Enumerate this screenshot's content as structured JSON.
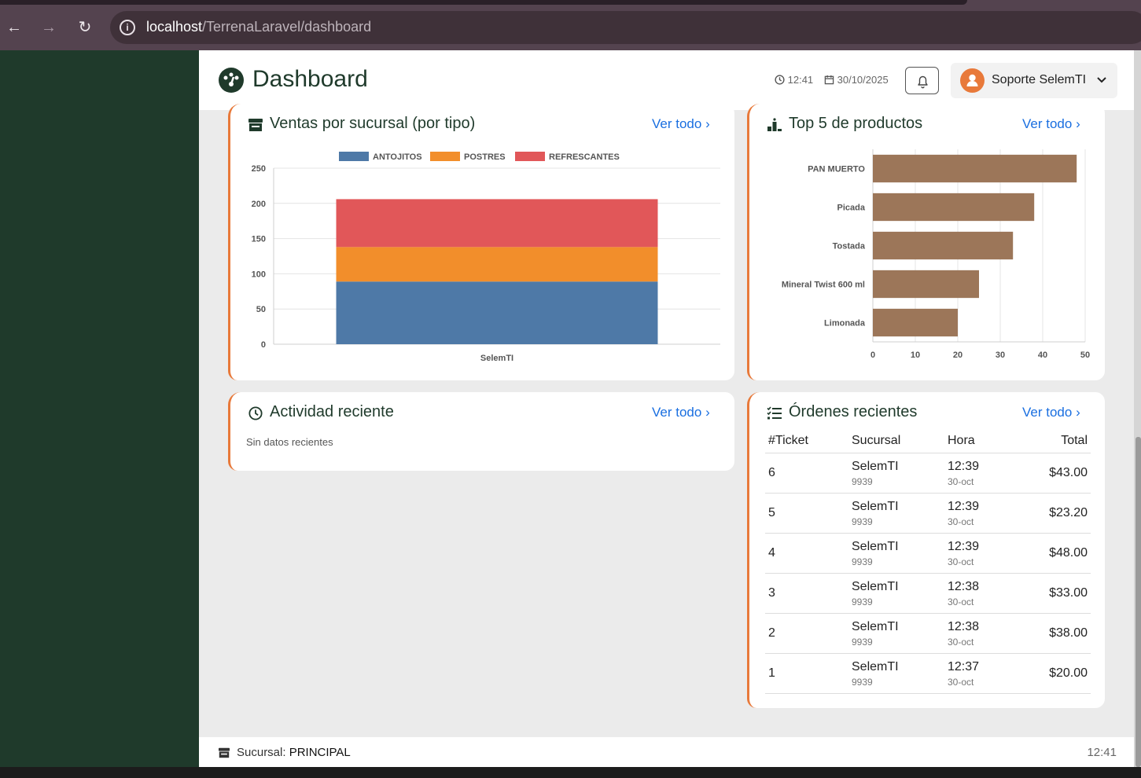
{
  "browser": {
    "url_host": "localhost",
    "url_path": "/TerrenaLaravel/dashboard",
    "back_icon": "←",
    "forward_icon": "→",
    "reload_icon": "↻",
    "info_icon": "i"
  },
  "header": {
    "title": "Dashboard",
    "time": "12:41",
    "date": "30/10/2025",
    "user_name": "Soporte SelemTI",
    "user_chevron": "⌄"
  },
  "ventas_card": {
    "title": "Ventas por sucursal (por tipo)",
    "link": "Ver todo",
    "chevron": "›"
  },
  "top5_card": {
    "title": "Top 5 de productos",
    "link": "Ver todo",
    "chevron": "›"
  },
  "actividad_card": {
    "title": "Actividad reciente",
    "link": "Ver todo",
    "chevron": "›",
    "empty": "Sin datos recientes"
  },
  "ordenes_card": {
    "title": "Órdenes recientes",
    "link": "Ver todo",
    "chevron": "›",
    "columns": [
      "#Ticket",
      "Sucursal",
      "Hora",
      "Total"
    ],
    "rows": [
      {
        "ticket": "6",
        "sucursal": "SelemTI",
        "sucursal_code": "9939",
        "hora": "12:39",
        "fecha": "30-oct",
        "total": "$43.00"
      },
      {
        "ticket": "5",
        "sucursal": "SelemTI",
        "sucursal_code": "9939",
        "hora": "12:39",
        "fecha": "30-oct",
        "total": "$23.20"
      },
      {
        "ticket": "4",
        "sucursal": "SelemTI",
        "sucursal_code": "9939",
        "hora": "12:39",
        "fecha": "30-oct",
        "total": "$48.00"
      },
      {
        "ticket": "3",
        "sucursal": "SelemTI",
        "sucursal_code": "9939",
        "hora": "12:38",
        "fecha": "30-oct",
        "total": "$33.00"
      },
      {
        "ticket": "2",
        "sucursal": "SelemTI",
        "sucursal_code": "9939",
        "hora": "12:38",
        "fecha": "30-oct",
        "total": "$38.00"
      },
      {
        "ticket": "1",
        "sucursal": "SelemTI",
        "sucursal_code": "9939",
        "hora": "12:37",
        "fecha": "30-oct",
        "total": "$20.00"
      }
    ]
  },
  "footer": {
    "label": "Sucursal:",
    "branch": "PRINCIPAL",
    "time": "12:41"
  },
  "colors": {
    "sidebar": "#1f3a2b",
    "accent": "#e8793a",
    "link": "#1a6fe0",
    "antojitos": "#4e79a7",
    "postres": "#f28e2b",
    "refrescantes": "#e15759",
    "top5_bar": "#9c7659"
  },
  "chart_data": [
    {
      "type": "bar",
      "stacked": true,
      "categories": [
        "SelemTI"
      ],
      "series": [
        {
          "name": "ANTOJITOS",
          "values": [
            89
          ]
        },
        {
          "name": "POSTRES",
          "values": [
            49
          ]
        },
        {
          "name": "REFRESCANTES",
          "values": [
            68
          ]
        }
      ],
      "ylim": [
        0,
        250
      ],
      "yticks": [
        0,
        50,
        100,
        150,
        200,
        250
      ],
      "legend": "top",
      "grid": true
    },
    {
      "type": "bar",
      "orientation": "horizontal",
      "categories": [
        "PAN MUERTO",
        "Picada",
        "Tostada",
        "Mineral Twist 600 ml",
        "Limonada"
      ],
      "values": [
        48,
        38,
        33,
        25,
        20
      ],
      "xlim": [
        0,
        50
      ],
      "xticks": [
        0,
        10,
        20,
        30,
        40,
        50
      ],
      "grid": true
    }
  ]
}
